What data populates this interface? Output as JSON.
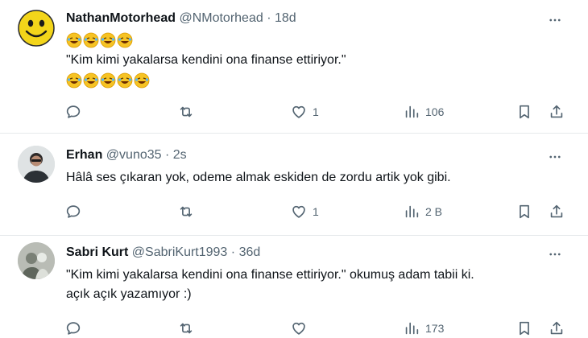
{
  "tweets": [
    {
      "name": "NathanMotorhead",
      "handle": "@NMotorhead",
      "dot": "·",
      "time": "18d",
      "lines": [
        "\"Kim kimi yakalarsa kendini ona finanse ettiriyor.\""
      ],
      "emoji_row_1": [
        "🤣",
        "🤣",
        "🤣",
        "🤣"
      ],
      "emoji_row_2": [
        "🤣",
        "🤣",
        "🤣",
        "🤣",
        "🤣"
      ],
      "actions": {
        "reply": "",
        "retweet": "",
        "like": "1",
        "views": "106"
      }
    },
    {
      "name": "Erhan",
      "handle": "@vuno35",
      "dot": "·",
      "time": "2s",
      "lines": [
        "Hâlâ ses çıkaran yok, odeme almak eskiden de zordu artik yok gibi."
      ],
      "actions": {
        "reply": "",
        "retweet": "",
        "like": "1",
        "views": "2 B"
      }
    },
    {
      "name": "Sabri Kurt",
      "handle": "@SabriKurt1993",
      "dot": "·",
      "time": "36d",
      "lines": [
        "\"Kim kimi yakalarsa kendini ona finanse ettiriyor.\" okumuş adam tabii ki.",
        "açık açık yazamıyor :)"
      ],
      "actions": {
        "reply": "",
        "retweet": "",
        "like": "",
        "views": "173"
      }
    }
  ],
  "icons": {
    "reply": "reply-icon",
    "retweet": "retweet-icon",
    "like": "heart-icon",
    "views": "views-icon",
    "bookmark": "bookmark-icon",
    "share": "share-icon",
    "more": "more-icon"
  },
  "colors": {
    "text": "#0f1419",
    "muted": "#536471",
    "divider": "#e6e9eb"
  }
}
